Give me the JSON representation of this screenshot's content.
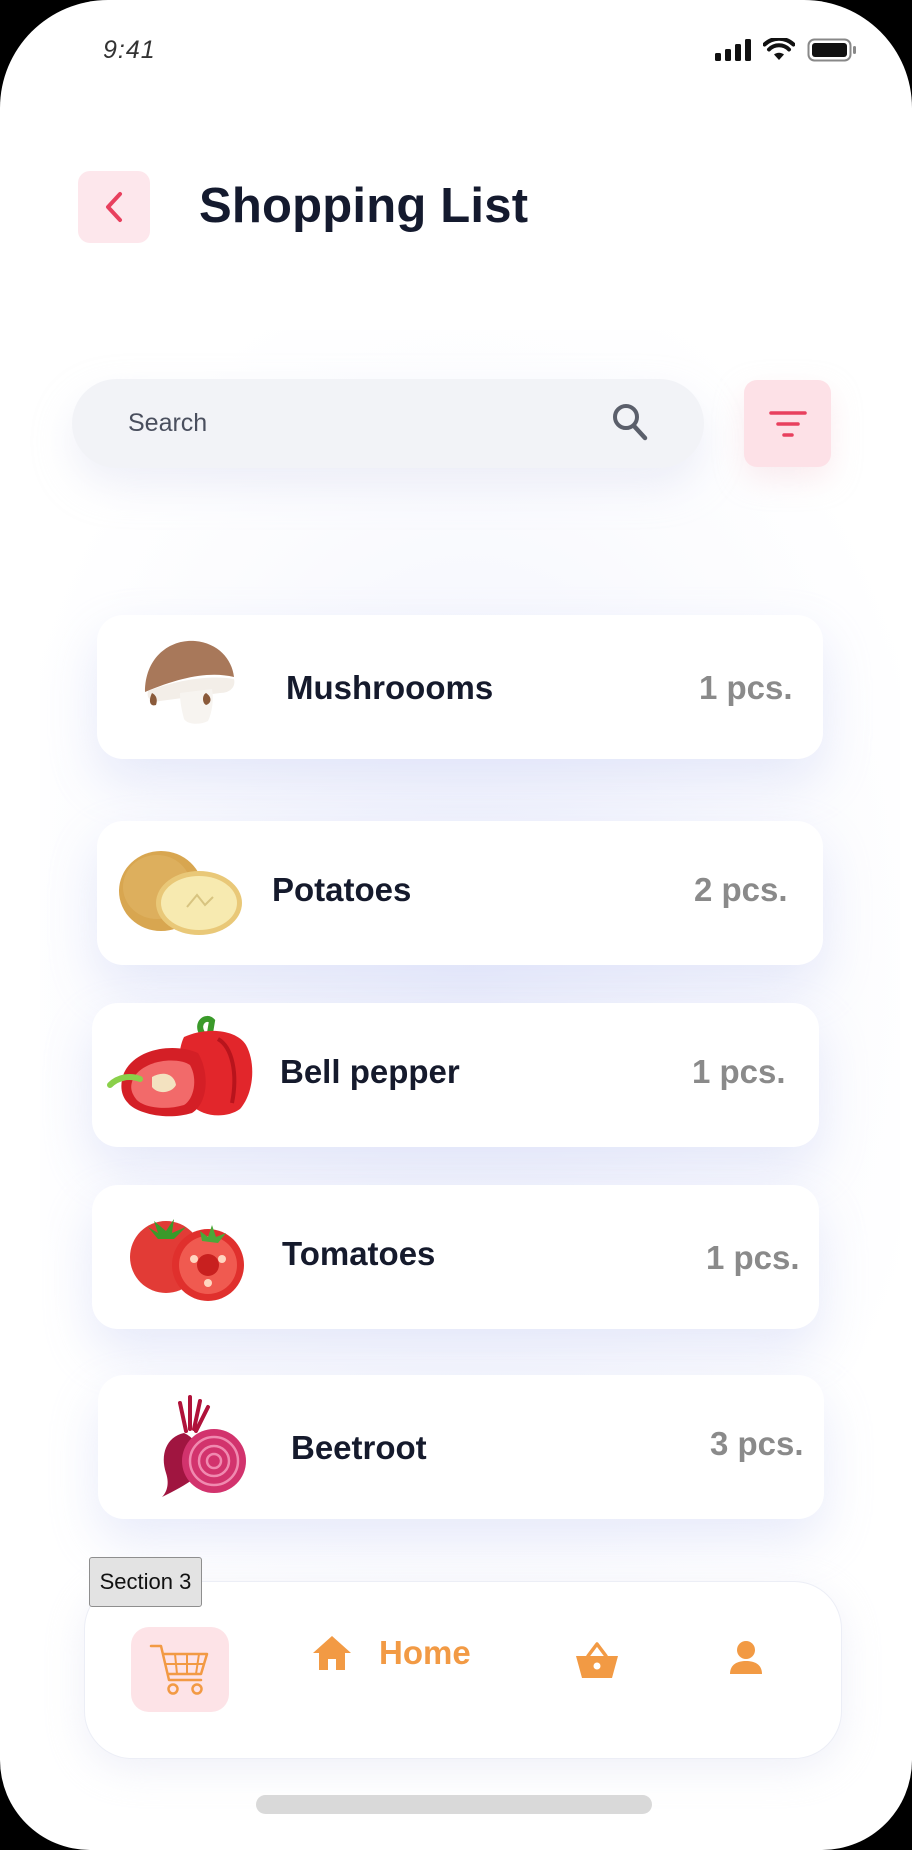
{
  "status_bar": {
    "time": "9:41"
  },
  "header": {
    "title": "Shopping List"
  },
  "search": {
    "placeholder": "Search"
  },
  "items": [
    {
      "name": "Mushroooms",
      "qty": "1 pcs.",
      "icon": "mushroom-image"
    },
    {
      "name": "Potatoes",
      "qty": "2 pcs.",
      "icon": "potato-image"
    },
    {
      "name": "Bell pepper",
      "qty": "1 pcs.",
      "icon": "bell-pepper-image"
    },
    {
      "name": "Tomatoes",
      "qty": "1 pcs.",
      "icon": "tomato-image"
    },
    {
      "name": "Beetroot",
      "qty": "3 pcs.",
      "icon": "beetroot-image"
    }
  ],
  "section_label": "Section 3",
  "nav": {
    "home_label": "Home",
    "icons": [
      "cart-icon",
      "home-icon",
      "basket-icon",
      "user-icon"
    ]
  },
  "colors": {
    "accent_pink": "#e8405e",
    "pink_bg": "#fde7ec",
    "accent_orange": "#f29a44",
    "title": "#141a2e",
    "qty_gray": "#8a8a8a"
  }
}
